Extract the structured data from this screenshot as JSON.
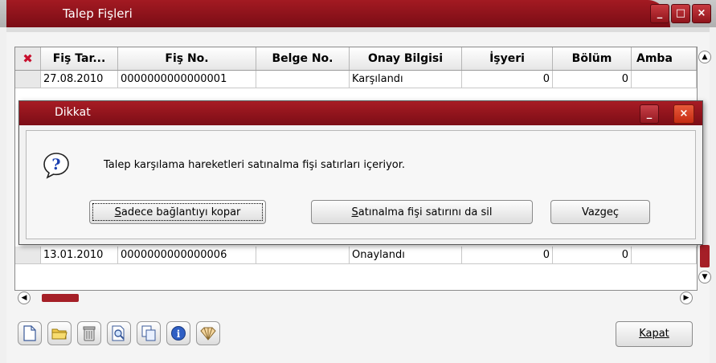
{
  "window": {
    "title": "Talep Fişleri",
    "controls": {
      "minimize": "_",
      "maximize": "□",
      "close": "×"
    }
  },
  "grid": {
    "columns": [
      "Fiş Tar...",
      "Fiş No.",
      "Belge No.",
      "Onay Bilgisi",
      "İşyeri",
      "Bölüm",
      "Amba"
    ],
    "rows": [
      {
        "date": "27.08.2010",
        "doc_no": "0000000000000001",
        "belge": "",
        "status": "Karşılandı",
        "isyeri": "0",
        "bolum": "0",
        "ambar": ""
      },
      {
        "date": "13.01.2010",
        "doc_no": "0000000000000006",
        "belge": "",
        "status": "Onaylandı",
        "isyeri": "0",
        "bolum": "0",
        "ambar": ""
      }
    ]
  },
  "toolbar": {
    "icons": [
      "new-document-icon",
      "open-folder-icon",
      "delete-icon",
      "search-icon",
      "copy-icon",
      "info-icon",
      "shell-icon"
    ],
    "close_button": {
      "accel": "K",
      "rest": "apat"
    }
  },
  "dialog": {
    "title": "Dikkat",
    "icon": "question-icon",
    "message": "Talep karşılama hareketleri satınalma fişi satırları içeriyor.",
    "buttons": {
      "disconnect": {
        "accel": "S",
        "rest": "adece bağlantıyı kopar"
      },
      "delete_line": {
        "accel": "S",
        "rest": "atınalma fişi satırını da sil"
      },
      "cancel": {
        "label": "Vazgeç"
      }
    },
    "controls": {
      "minimize": "_",
      "close": "×"
    }
  },
  "colors": {
    "accent": "#a51f27",
    "accent_dark": "#7a0c15"
  }
}
